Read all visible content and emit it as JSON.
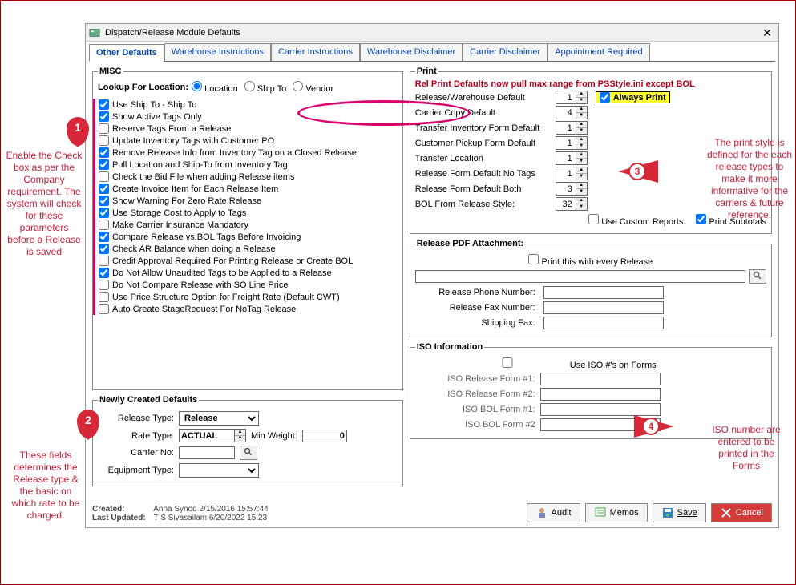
{
  "window": {
    "title": "Dispatch/Release Module Defaults"
  },
  "tabs": [
    "Other Defaults",
    "Warehouse Instructions",
    "Carrier Instructions",
    "Warehouse Disclaimer",
    "Carrier Disclaimer",
    "Appointment Required"
  ],
  "misc": {
    "legend": "MISC",
    "lookup_label": "Lookup For Location:",
    "radios": {
      "location": "Location",
      "shipto": "Ship To",
      "vendor": "Vendor"
    },
    "checks": [
      {
        "label": "Use Ship To - Ship To",
        "checked": true
      },
      {
        "label": "Show Active Tags Only",
        "checked": true
      },
      {
        "label": "Reserve Tags From a Release",
        "checked": false
      },
      {
        "label": "Update Inventory Tags with Customer PO",
        "checked": false
      },
      {
        "label": "Remove Release Info from Inventory Tag on a Closed Release",
        "checked": true
      },
      {
        "label": "Pull Location and Ship-To from Inventory Tag",
        "checked": true
      },
      {
        "label": "Check the Bid File when adding Release items",
        "checked": false
      },
      {
        "label": "Create Invoice Item for Each Release Item",
        "checked": true
      },
      {
        "label": "Show Warning For Zero Rate Release",
        "checked": true
      },
      {
        "label": "Use Storage Cost to Apply to Tags",
        "checked": true
      },
      {
        "label": "Make Carrier Insurance Mandatory",
        "checked": false
      },
      {
        "label": "Compare Release vs.BOL Tags Before Invoicing",
        "checked": true
      },
      {
        "label": "Check AR Balance when doing a Release",
        "checked": true
      },
      {
        "label": "Credit Approval Required For Printing Release or Create BOL",
        "checked": false
      },
      {
        "label": "Do Not Allow Unaudited Tags to be Applied to a Release",
        "checked": true
      },
      {
        "label": "Do Not Compare Release with SO Line Price",
        "checked": false
      },
      {
        "label": "Use Price Structure Option for Freight Rate (Default CWT)",
        "checked": false
      },
      {
        "label": "Auto Create StageRequest For NoTag Release",
        "checked": false
      }
    ]
  },
  "newly": {
    "legend": "Newly Created Defaults",
    "release_type_label": "Release Type:",
    "release_type_value": "Release",
    "rate_type_label": "Rate Type:",
    "rate_type_value": "ACTUAL",
    "min_weight_label": "Min Weight:",
    "min_weight_value": "0",
    "carrier_no_label": "Carrier No:",
    "carrier_no_value": "",
    "equipment_type_label": "Equipment Type:",
    "equipment_type_value": ""
  },
  "print": {
    "legend": "Print",
    "note": "Rel Print Defaults now pull max range from PSStyle.ini except BOL",
    "rows": [
      {
        "label": "Release/Warehouse Default",
        "value": "1"
      },
      {
        "label": "Carrier Copy Default",
        "value": "4"
      },
      {
        "label": "Transfer Inventory Form Default",
        "value": "1"
      },
      {
        "label": "Customer Pickup Form Default",
        "value": "1"
      },
      {
        "label": "Transfer Location",
        "value": "1"
      },
      {
        "label": "Release Form Default No Tags",
        "value": "1"
      },
      {
        "label": "Release Form Default Both",
        "value": "3"
      },
      {
        "label": "BOL From Release Style:",
        "value": "32"
      }
    ],
    "always_print_label": "Always Print",
    "use_custom_reports_label": "Use Custom Reports",
    "print_subtotals_label": "Print Subtotals"
  },
  "pdf": {
    "legend": "Release PDF Attachment:",
    "print_every_label": "Print this with every Release",
    "path_value": "",
    "phone_label": "Release Phone Number:",
    "phone_value": "",
    "fax_label": "Release Fax Number:",
    "fax_value": "",
    "ship_fax_label": "Shipping Fax:",
    "ship_fax_value": ""
  },
  "iso": {
    "legend": "ISO Information",
    "use_iso_label": "Use ISO #'s on Forms",
    "rows": [
      {
        "label": "ISO Release Form #1:",
        "value": ""
      },
      {
        "label": "ISO Release Form #2:",
        "value": ""
      },
      {
        "label": "ISO BOL Form #1:",
        "value": ""
      },
      {
        "label": "ISO BOL Form #2",
        "value": ""
      }
    ]
  },
  "footer": {
    "created_label": "Created:",
    "created_value": "Anna Synod 2/15/2016 15:57:44",
    "updated_label": "Last Updated:",
    "updated_value": "T S Sivasailam 6/20/2022 15:23",
    "audit": "Audit",
    "memos": "Memos",
    "save": "Save",
    "cancel": "Cancel"
  },
  "annotations": {
    "a1": "Enable the Check box as per the Company requirement. The system will check for these parameters before a Release is saved",
    "a2": "These fields determines the Release type & the basic on which rate to be charged.",
    "a3": "The print style is defined for the each release types to make it more informative for the carriers & future reference.",
    "a4": "ISO number are entered to be printed in the Forms"
  }
}
